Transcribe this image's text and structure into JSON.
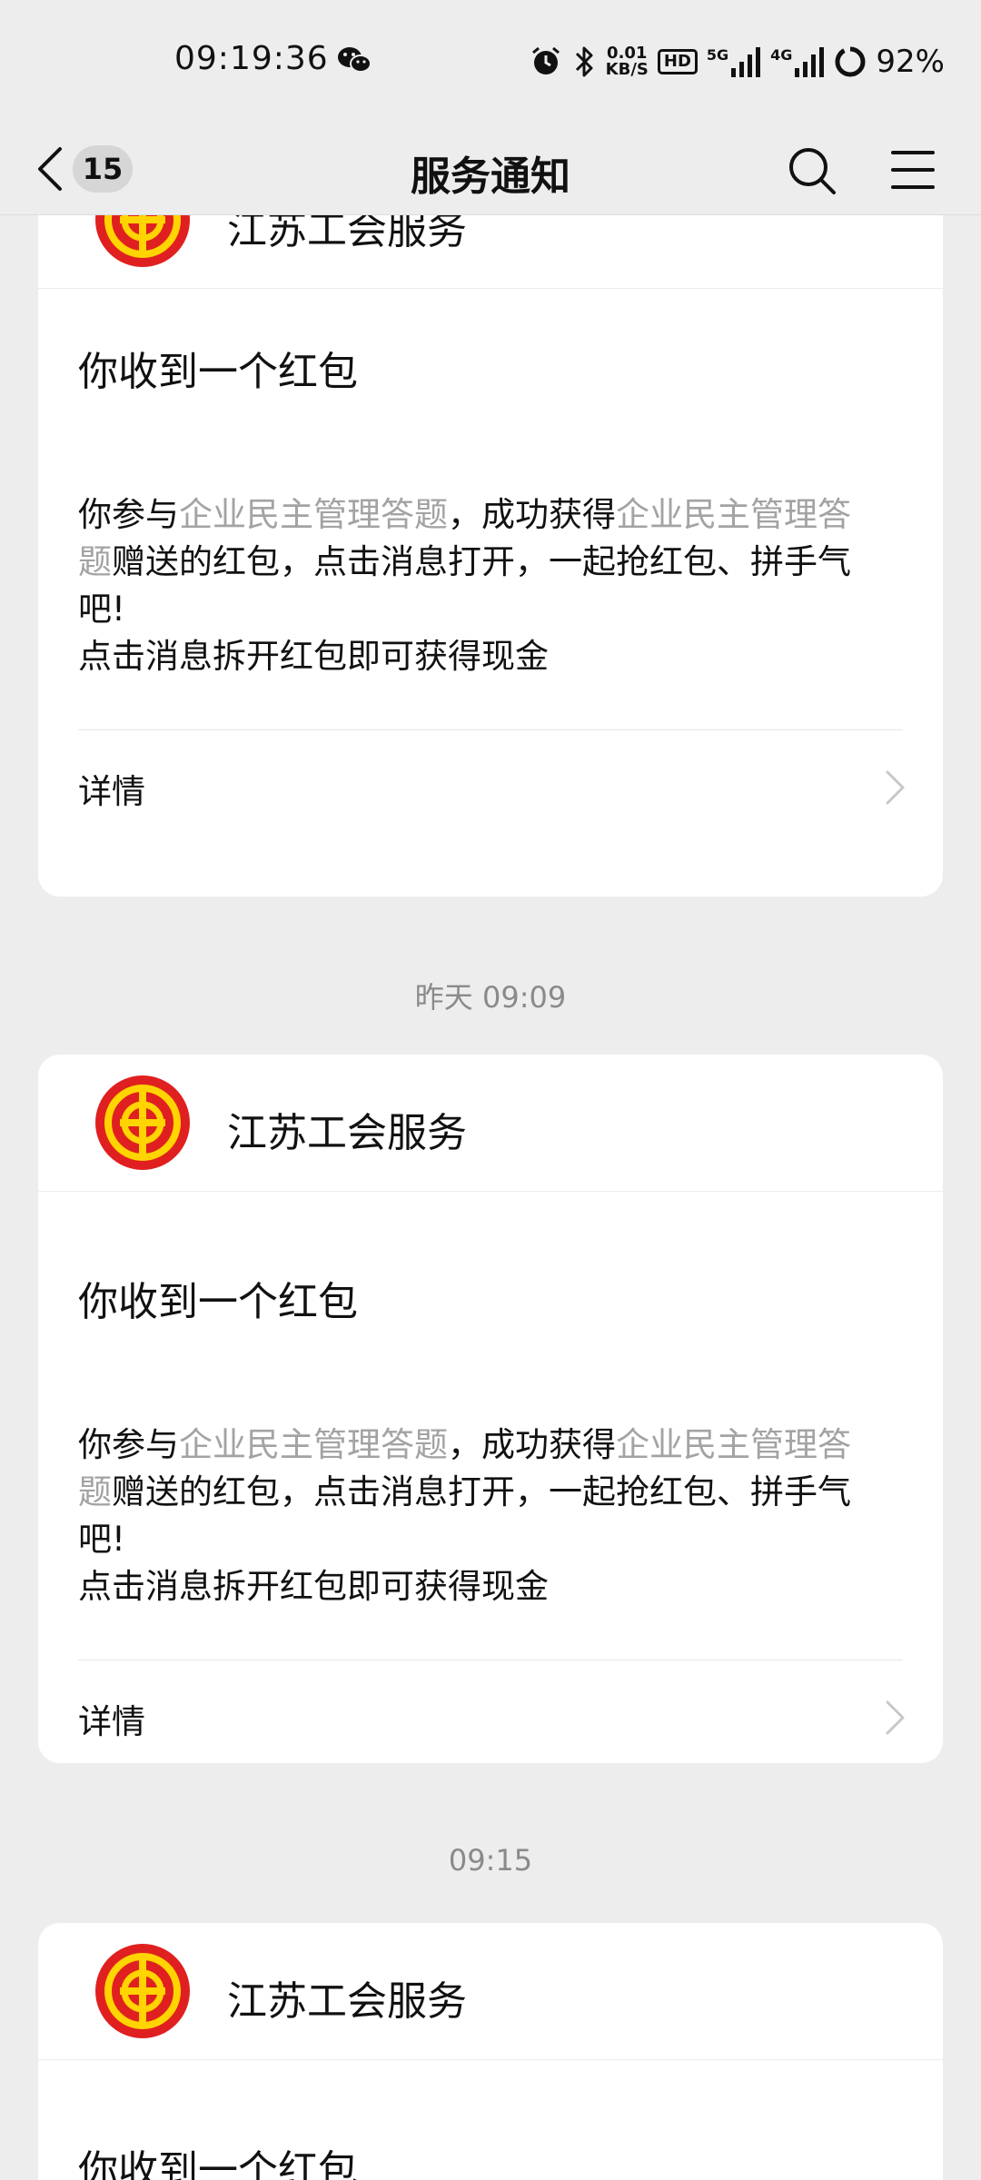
{
  "status_bar": {
    "time": "09:19:36",
    "net_speed_value": "0.01",
    "net_speed_unit": "KB/S",
    "hd_label": "HD",
    "sig1_label": "5G",
    "sig2_label": "4G",
    "battery": "92%"
  },
  "nav": {
    "badge_count": "15",
    "title": "服务通知"
  },
  "messages": [
    {
      "brand": "江苏工会服务",
      "title": "你收到一个红包",
      "body_prefix": "你参与",
      "link1": "企业民主管理答题",
      "body_mid": "，成功获得",
      "link2_line1": "企业民主管理答",
      "link2_line2": "题",
      "body_suffix_line2": "赠送的红包，点击消息打开，一起抢红包、拼手气",
      "body_suffix_line3": "吧!",
      "body_line4": "点击消息拆开红包即可获得现金",
      "detail_label": "详情"
    },
    {
      "timestamp": "昨天 09:09",
      "brand": "江苏工会服务",
      "title": "你收到一个红包",
      "body_prefix": "你参与",
      "link1": "企业民主管理答题",
      "body_mid": "，成功获得",
      "link2_line1": "企业民主管理答",
      "link2_line2": "题",
      "body_suffix_line2": "赠送的红包，点击消息打开，一起抢红包、拼手气",
      "body_suffix_line3": "吧!",
      "body_line4": "点击消息拆开红包即可获得现金",
      "detail_label": "详情"
    },
    {
      "timestamp": "09:15",
      "brand": "江苏工会服务",
      "title": "你收到一个红包"
    }
  ],
  "colors": {
    "logo_red": "#e02020",
    "logo_yellow": "#ffd400",
    "link_gray": "#a3a3a3",
    "background": "#ededed"
  }
}
